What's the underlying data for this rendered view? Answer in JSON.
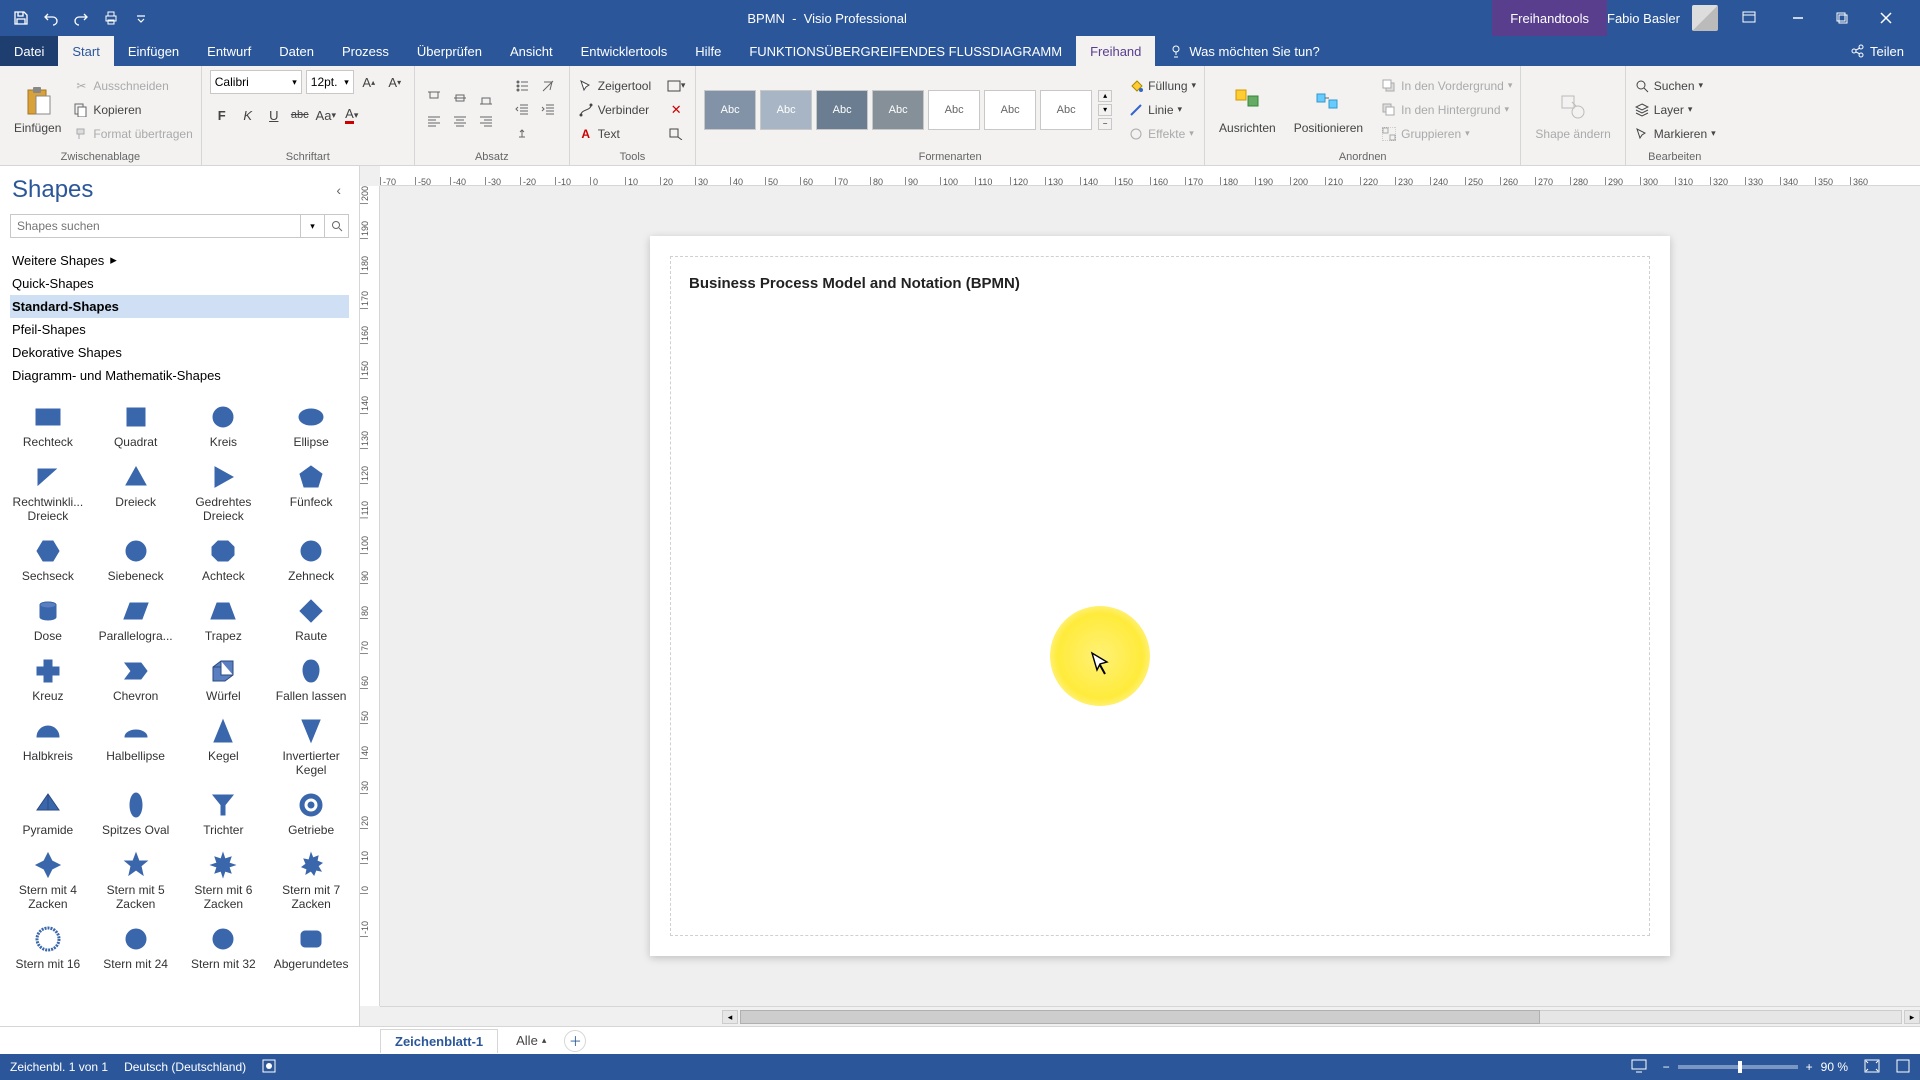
{
  "title_bar": {
    "doc_name": "BPMN",
    "app_name": "Visio Professional",
    "context_tool": "Freihandtools",
    "user_name": "Fabio Basler"
  },
  "tabs": {
    "file": "Datei",
    "main": [
      "Start",
      "Einfügen",
      "Entwurf",
      "Daten",
      "Prozess",
      "Überprüfen",
      "Ansicht",
      "Entwicklertools",
      "Hilfe",
      "FUNKTIONSÜBERGREIFENDES FLUSSDIAGRAMM",
      "Freihand"
    ],
    "active_index": 0,
    "tell_me_placeholder": "Was möchten Sie tun?",
    "share": "Teilen"
  },
  "ribbon": {
    "clipboard": {
      "label": "Zwischenablage",
      "paste": "Einfügen",
      "cut": "Ausschneiden",
      "copy": "Kopieren",
      "format": "Format übertragen"
    },
    "font": {
      "label": "Schriftart",
      "name": "Calibri",
      "size": "12pt.",
      "bold": "F",
      "italic": "K",
      "underline": "U",
      "strike": "abc",
      "case": "Aa",
      "color": "A"
    },
    "paragraph": {
      "label": "Absatz"
    },
    "tools": {
      "label": "Tools",
      "pointer": "Zeigertool",
      "connector": "Verbinder",
      "text": "Text",
      "x": "✕"
    },
    "styles": {
      "label": "Formenarten",
      "sample": "Abc",
      "fill": "Füllung",
      "line": "Linie",
      "effects": "Effekte"
    },
    "arrange": {
      "label": "Anordnen",
      "align": "Ausrichten",
      "position": "Positionieren",
      "front": "In den Vordergrund",
      "back": "In den Hintergrund",
      "group": "Gruppieren"
    },
    "shape_change": {
      "label": "",
      "btn": "Shape ändern"
    },
    "edit": {
      "label": "Bearbeiten",
      "find": "Suchen",
      "layer": "Layer",
      "select": "Markieren"
    }
  },
  "shapes_pane": {
    "title": "Shapes",
    "search_placeholder": "Shapes suchen",
    "stencils": {
      "more": "Weitere Shapes",
      "items": [
        "Quick-Shapes",
        "Standard-Shapes",
        "Pfeil-Shapes",
        "Dekorative Shapes",
        "Diagramm- und Mathematik-Shapes"
      ],
      "active_index": 1
    },
    "shapes": [
      "Rechteck",
      "Quadrat",
      "Kreis",
      "Ellipse",
      "Rechtwinkli... Dreieck",
      "Dreieck",
      "Gedrehtes Dreieck",
      "Fünfeck",
      "Sechseck",
      "Siebeneck",
      "Achteck",
      "Zehneck",
      "Dose",
      "Parallelogra...",
      "Trapez",
      "Raute",
      "Kreuz",
      "Chevron",
      "Würfel",
      "Fallen lassen",
      "Halbkreis",
      "Halbellipse",
      "Kegel",
      "Invertierter Kegel",
      "Pyramide",
      "Spitzes Oval",
      "Trichter",
      "Getriebe",
      "Stern mit 4 Zacken",
      "Stern mit 5 Zacken",
      "Stern mit 6 Zacken",
      "Stern mit 7 Zacken",
      "Stern mit 16",
      "Stern mit 24",
      "Stern mit 32",
      "Abgerundetes"
    ]
  },
  "canvas": {
    "page_title": "Business Process Model and Notation (BPMN)",
    "h_ticks": [
      "-70",
      "-50",
      "-40",
      "-30",
      "-20",
      "-10",
      "0",
      "10",
      "20",
      "30",
      "40",
      "50",
      "60",
      "70",
      "80",
      "90",
      "100",
      "110",
      "120",
      "130",
      "140",
      "150",
      "160",
      "170",
      "180",
      "190",
      "200",
      "210",
      "220",
      "230",
      "240",
      "250",
      "260",
      "270",
      "280",
      "290",
      "300",
      "310",
      "320",
      "330",
      "340",
      "350",
      "360"
    ],
    "v_ticks": [
      "200",
      "190",
      "180",
      "170",
      "160",
      "150",
      "140",
      "130",
      "120",
      "110",
      "100",
      "90",
      "80",
      "70",
      "60",
      "50",
      "40",
      "30",
      "20",
      "10",
      "0",
      "-10"
    ]
  },
  "sheet_tabs": {
    "active": "Zeichenblatt-1",
    "all": "Alle"
  },
  "status": {
    "page_info": "Zeichenbl. 1 von 1",
    "language": "Deutsch (Deutschland)",
    "zoom": "90 %"
  }
}
